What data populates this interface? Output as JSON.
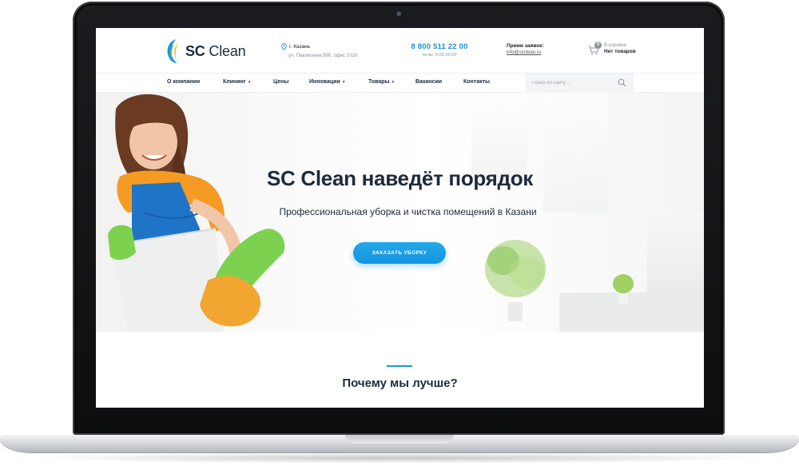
{
  "brand": {
    "name_bold": "SC",
    "name_light": "Clean",
    "colors": {
      "primary": "#1b95e0",
      "dark": "#1e2a3c",
      "accent_green": "#7ac143",
      "accent_orange": "#f5a623"
    }
  },
  "header": {
    "address_city": "г. Казань",
    "address_street": "ул. Павлюхина 99б, офис 1016",
    "phone": "8 800 511 22 00",
    "hours": "пн-вс: 9:00-20:00",
    "orders_label": "Прием заявок:",
    "orders_email": "info@scclean.ru",
    "cart_label": "В корзине:",
    "cart_status": "Нет товаров",
    "cart_count": "0"
  },
  "nav": {
    "items": [
      {
        "label": "О компании",
        "has_dropdown": false
      },
      {
        "label": "Клининг",
        "has_dropdown": true
      },
      {
        "label": "Цены",
        "has_dropdown": false
      },
      {
        "label": "Инновации",
        "has_dropdown": true
      },
      {
        "label": "Товары",
        "has_dropdown": true
      },
      {
        "label": "Вакансии",
        "has_dropdown": false
      },
      {
        "label": "Контакты",
        "has_dropdown": false
      }
    ],
    "search_placeholder": "Поиск по сайту ..."
  },
  "hero": {
    "title": "SC Clean наведёт порядок",
    "subtitle": "Профессиональная уборка и чистка помещений в Казани",
    "button_label": "ЗАКАЗАТЬ УБОРКУ"
  },
  "section": {
    "title": "Почему мы лучше?"
  }
}
